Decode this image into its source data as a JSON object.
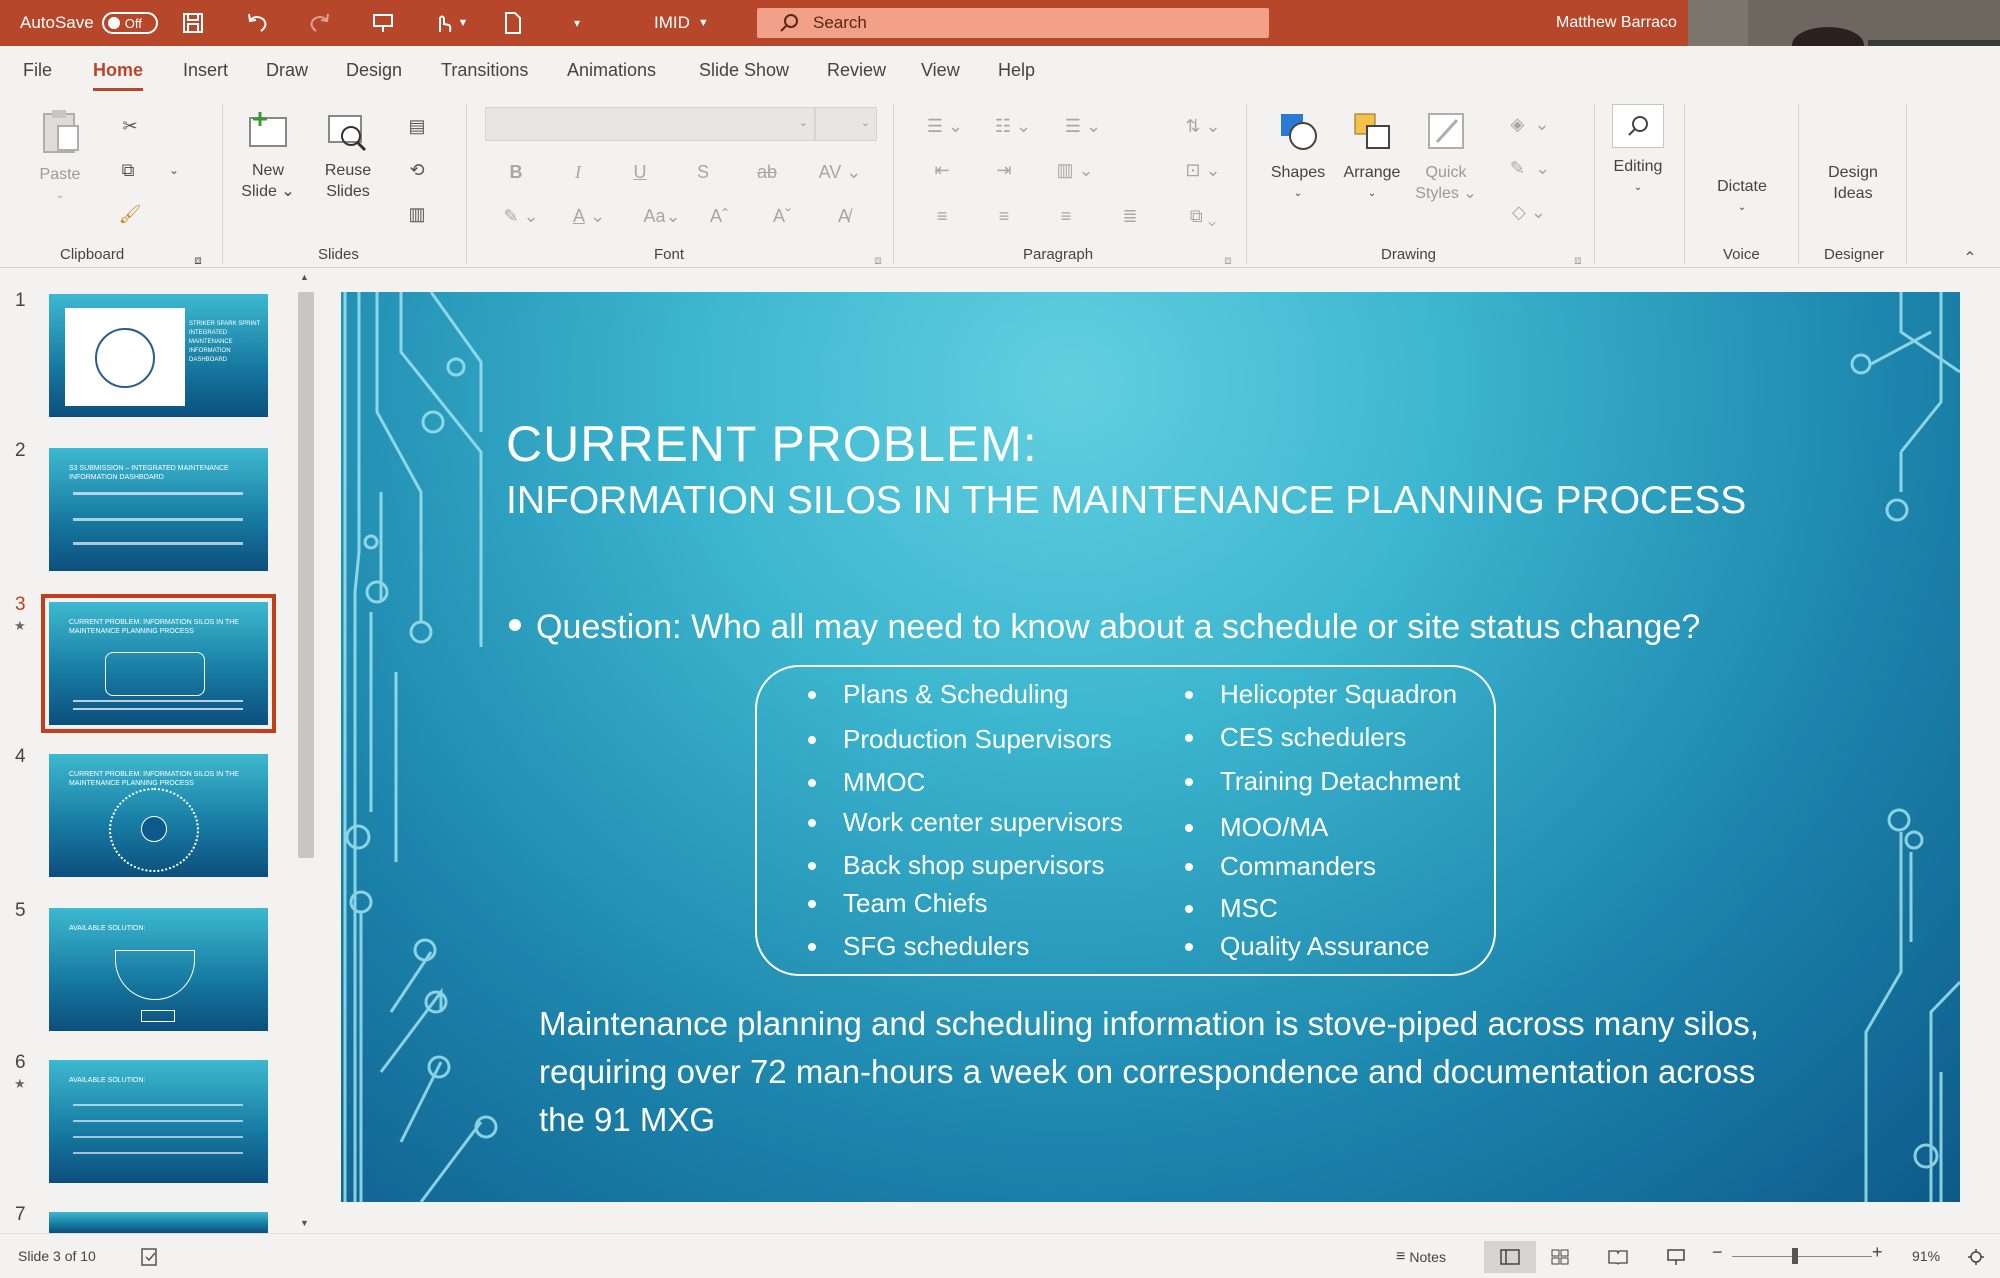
{
  "titlebar": {
    "autosave_label": "AutoSave",
    "autosave_state": "Off",
    "file_name": "IMID",
    "search_placeholder": "Search",
    "user_name": "Matthew Barraco"
  },
  "tabs": [
    {
      "label": "File"
    },
    {
      "label": "Home"
    },
    {
      "label": "Insert"
    },
    {
      "label": "Draw"
    },
    {
      "label": "Design"
    },
    {
      "label": "Transitions"
    },
    {
      "label": "Animations"
    },
    {
      "label": "Slide Show"
    },
    {
      "label": "Review"
    },
    {
      "label": "View"
    },
    {
      "label": "Help"
    }
  ],
  "ribbon": {
    "paste_label": "Paste",
    "new_slide_label": [
      "New",
      "Slide"
    ],
    "reuse_slides_label": [
      "Reuse",
      "Slides"
    ],
    "shapes_label": "Shapes",
    "arrange_label": "Arrange",
    "quick_styles_label": [
      "Quick",
      "Styles"
    ],
    "editing_label": "Editing",
    "dictate_label": "Dictate",
    "design_ideas_label": [
      "Design",
      "Ideas"
    ],
    "groups": {
      "clipboard": "Clipboard",
      "slides": "Slides",
      "font": "Font",
      "paragraph": "Paragraph",
      "drawing": "Drawing",
      "voice": "Voice",
      "designer": "Designer"
    }
  },
  "thumbnails": [
    {
      "num": "1",
      "text": "STRIKER SPARK SPRINT INTEGRATED MAINTENANCE INFORMATION DASHBOARD"
    },
    {
      "num": "2",
      "text": "S3 SUBMISSION – INTEGRATED MAINTENANCE INFORMATION DASHBOARD"
    },
    {
      "num": "3",
      "text": "CURRENT PROBLEM: INFORMATION SILOS IN THE MAINTENANCE PLANNING PROCESS"
    },
    {
      "num": "4",
      "text": "CURRENT PROBLEM: INFORMATION SILOS IN THE MAINTENANCE PLANNING PROCESS"
    },
    {
      "num": "5",
      "text": "AVAILABLE SOLUTION:"
    },
    {
      "num": "6",
      "text": "AVAILABLE SOLUTION:"
    },
    {
      "num": "7",
      "text": ""
    }
  ],
  "slide": {
    "title": "CURRENT PROBLEM:",
    "subtitle": "INFORMATION SILOS IN THE MAINTENANCE PLANNING PROCESS",
    "question": "Question: Who all may need to know about a schedule or site status change?",
    "roles_left": [
      "Plans & Scheduling",
      "Production Supervisors",
      "MMOC",
      "Work center supervisors",
      "Back shop supervisors",
      "Team Chiefs",
      "SFG schedulers"
    ],
    "roles_right": [
      "Helicopter Squadron",
      "CES schedulers",
      "Training Detachment",
      "MOO/MA",
      "Commanders",
      "MSC",
      "Quality Assurance"
    ],
    "body": "Maintenance planning and scheduling information is stove-piped across many silos, requiring over 72 man-hours a week on correspondence and documentation across the 91 MXG"
  },
  "status": {
    "slide_counter": "Slide 3 of 10",
    "notes_label": "Notes",
    "zoom": "91%"
  },
  "colors": {
    "accent": "#b7472a",
    "selection": "#c43e1c"
  }
}
